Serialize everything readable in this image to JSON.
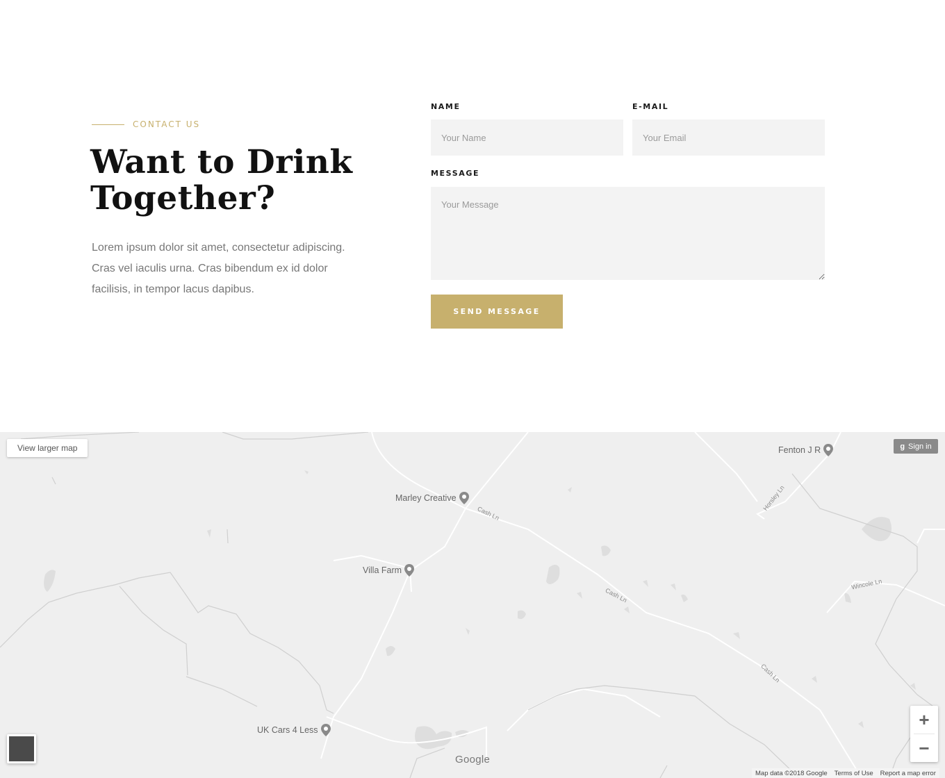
{
  "contact": {
    "eyebrow": "CONTACT US",
    "title_line1": "Want to Drink",
    "title_line2": "Together?",
    "intro": "Lorem ipsum dolor sit amet, consectetur adipiscing. Cras vel iaculis urna. Cras bibendum ex id dolor facilisis, in tempor lacus dapibus."
  },
  "form": {
    "name_label": "NAME",
    "name_placeholder": "Your Name",
    "email_label": "E-MAIL",
    "email_placeholder": "Your Email",
    "message_label": "MESSAGE",
    "message_placeholder": "Your Message",
    "submit_label": "SEND MESSAGE"
  },
  "map": {
    "view_larger_label": "View larger map",
    "sign_in_label": "Sign in",
    "places": [
      "Marley Creative",
      "Villa Farm",
      "Fenton J R",
      "UK Cars 4 Less"
    ],
    "roads": [
      "Cash Ln",
      "Cash Ln",
      "Cash Ln",
      "Horsley Ln",
      "Wincole Ln"
    ],
    "zoom_in": "+",
    "zoom_out": "−",
    "logo": "Google",
    "attribution": [
      "Map data ©2018 Google",
      "Terms of Use",
      "Report a map error"
    ]
  },
  "colors": {
    "accent": "#c7b06d",
    "heading": "#111111",
    "body_text": "#777777",
    "field_bg": "#f3f3f3",
    "map_bg": "#efefef"
  },
  "icons": [
    "map-pin-icon",
    "google-g-icon",
    "plus-icon",
    "minus-icon",
    "street-view-icon"
  ]
}
